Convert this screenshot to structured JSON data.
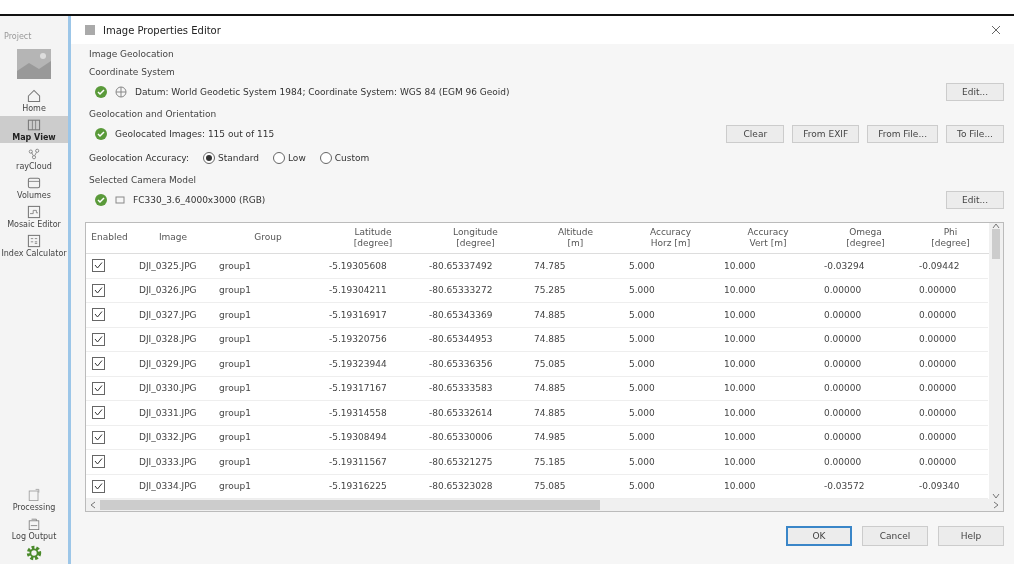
{
  "sidebar": {
    "project_label": "Project",
    "items": [
      {
        "label": "Home",
        "selected": false
      },
      {
        "label": "Map View",
        "selected": true
      },
      {
        "label": "rayCloud",
        "selected": false
      },
      {
        "label": "Volumes",
        "selected": false
      },
      {
        "label": "Mosaic Editor",
        "selected": false
      },
      {
        "label": "Index Calculator",
        "selected": false
      }
    ],
    "bottom_items": [
      {
        "label": "Processing"
      },
      {
        "label": "Log Output"
      }
    ]
  },
  "dialog": {
    "title": "Image Properties Editor",
    "section_title": "Image Geolocation",
    "coordinate_system": {
      "heading": "Coordinate System",
      "text": "Datum: World Geodetic System 1984; Coordinate System: WGS 84 (EGM 96 Geoid)",
      "button": "Edit..."
    },
    "geolocation": {
      "heading": "Geolocation and Orientation",
      "text": "Geolocated Images: 115 out of 115",
      "buttons": [
        "Clear",
        "From EXIF",
        "From File...",
        "To File..."
      ],
      "accuracy_label": "Geolocation Accuracy:",
      "accuracy_options": [
        {
          "label": "Standard",
          "selected": true
        },
        {
          "label": "Low",
          "selected": false
        },
        {
          "label": "Custom",
          "selected": false
        }
      ]
    },
    "camera": {
      "heading": "Selected Camera Model",
      "text": "FC330_3.6_4000x3000 (RGB)",
      "button": "Edit..."
    },
    "table": {
      "checkbox_column": "Enabled",
      "columns": [
        "Image",
        "Group",
        "Latitude\n[degree]",
        "Longitude\n[degree]",
        "Altitude\n[m]",
        "Accuracy\nHorz [m]",
        "Accuracy\nVert [m]",
        "Omega\n[degree]",
        "Phi\n[degree]"
      ],
      "rows": [
        {
          "enabled": true,
          "cells": [
            "DJI_0325.JPG",
            "group1",
            "-5.19305608",
            "-80.65337492",
            "74.785",
            "5.000",
            "10.000",
            "-0.03294",
            "-0.09442"
          ]
        },
        {
          "enabled": true,
          "cells": [
            "DJI_0326.JPG",
            "group1",
            "-5.19304211",
            "-80.65333272",
            "75.285",
            "5.000",
            "10.000",
            "0.00000",
            "0.00000"
          ]
        },
        {
          "enabled": true,
          "cells": [
            "DJI_0327.JPG",
            "group1",
            "-5.19316917",
            "-80.65343369",
            "74.885",
            "5.000",
            "10.000",
            "0.00000",
            "0.00000"
          ]
        },
        {
          "enabled": true,
          "cells": [
            "DJI_0328.JPG",
            "group1",
            "-5.19320756",
            "-80.65344953",
            "74.885",
            "5.000",
            "10.000",
            "0.00000",
            "0.00000"
          ]
        },
        {
          "enabled": true,
          "cells": [
            "DJI_0329.JPG",
            "group1",
            "-5.19323944",
            "-80.65336356",
            "75.085",
            "5.000",
            "10.000",
            "0.00000",
            "0.00000"
          ]
        },
        {
          "enabled": true,
          "cells": [
            "DJI_0330.JPG",
            "group1",
            "-5.19317167",
            "-80.65333583",
            "74.885",
            "5.000",
            "10.000",
            "0.00000",
            "0.00000"
          ]
        },
        {
          "enabled": true,
          "cells": [
            "DJI_0331.JPG",
            "group1",
            "-5.19314558",
            "-80.65332614",
            "74.885",
            "5.000",
            "10.000",
            "0.00000",
            "0.00000"
          ]
        },
        {
          "enabled": true,
          "cells": [
            "DJI_0332.JPG",
            "group1",
            "-5.19308494",
            "-80.65330006",
            "74.985",
            "5.000",
            "10.000",
            "0.00000",
            "0.00000"
          ]
        },
        {
          "enabled": true,
          "cells": [
            "DJI_0333.JPG",
            "group1",
            "-5.19311567",
            "-80.65321275",
            "75.185",
            "5.000",
            "10.000",
            "0.00000",
            "0.00000"
          ]
        },
        {
          "enabled": true,
          "cells": [
            "DJI_0334.JPG",
            "group1",
            "-5.19316225",
            "-80.65323028",
            "75.085",
            "5.000",
            "10.000",
            "-0.03572",
            "-0.09340"
          ]
        }
      ]
    },
    "footer_buttons": [
      {
        "label": "OK",
        "default": true
      },
      {
        "label": "Cancel",
        "default": false
      },
      {
        "label": "Help",
        "default": false
      }
    ]
  }
}
